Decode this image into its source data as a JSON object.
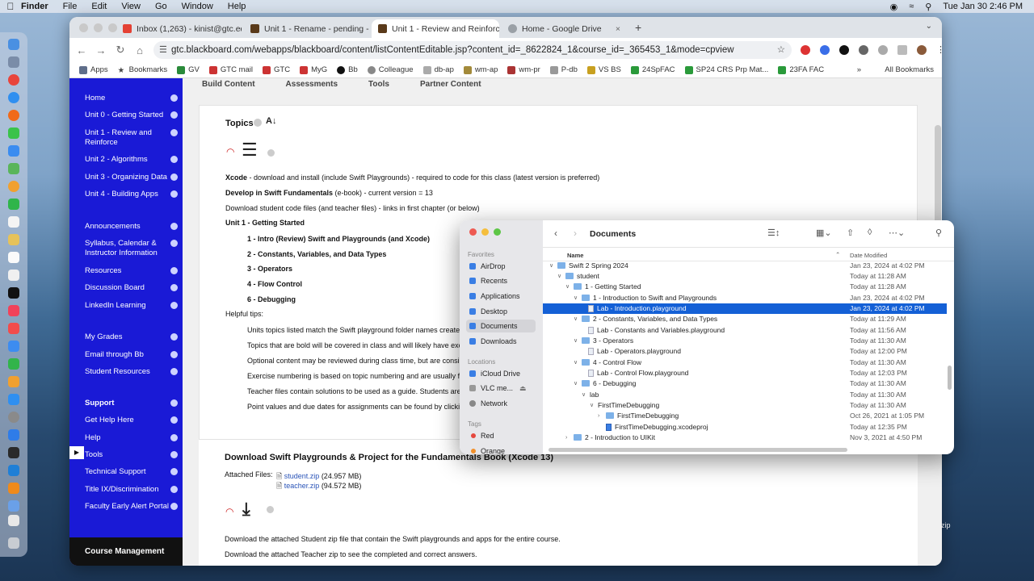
{
  "menubar": {
    "app": "Finder",
    "items": [
      "File",
      "Edit",
      "View",
      "Go",
      "Window",
      "Help"
    ],
    "clock": "Tue Jan 30  2:46 PM"
  },
  "browser": {
    "tabs": [
      {
        "label": "Inbox (1,263) - kinist@gtc.ed"
      },
      {
        "label": "Unit 1 - Rename - pending -"
      },
      {
        "label": "Unit 1 - Review and Reinforce"
      },
      {
        "label": "Home - Google Drive"
      }
    ],
    "new_tab": "+",
    "url": "gtc.blackboard.com/webapps/blackboard/content/listContentEditable.jsp?content_id=_8622824_1&course_id=_365453_1&mode=cpview",
    "bookmarks": [
      "Apps",
      "Bookmarks",
      "GV",
      "GTC mail",
      "GTC",
      "MyG",
      "Bb",
      "Colleague",
      "db-ap",
      "wm-ap",
      "wm-pr",
      "P-db",
      "VS BS",
      "24SpFAC",
      "SP24 CRS Prp Mat...",
      "23FA FAC"
    ],
    "all_bookmarks": "All Bookmarks"
  },
  "sidebar": {
    "items": [
      "Home",
      "Unit 0 - Getting Started",
      "Unit 1 - Review and Reinforce",
      "Unit 2 - Algorithms",
      "Unit 3 - Organizing Data",
      "Unit 4 - Building Apps",
      "Announcements",
      "Syllabus, Calendar & Instructor Information",
      "Resources",
      "Discussion Board",
      "LinkedIn Learning",
      "My Grades",
      "Email through Bb",
      "Student Resources",
      "Support",
      "Get Help Here",
      "Help",
      "Tools",
      "Technical Support",
      "Title IX/Discrimination",
      "Faculty Early Alert Portal"
    ],
    "course_management": "Course Management"
  },
  "main": {
    "toptabs": [
      "Build Content",
      "Assessments",
      "Tools",
      "Partner Content"
    ],
    "topics_title": "Topics",
    "line1_bold": "Xcode",
    "line1": " - download and install (include Swift Playgrounds) - required to code for this class (latest version is preferred)",
    "line2_bold": "Develop in Swift Fundamentals",
    "line2": " (e-book) - current version = 13",
    "line3": "Download student code files (and teacher files) - links in first chapter (or below)",
    "unit_heading": "Unit 1 - Getting Started",
    "topics": [
      "1 - Intro (Review) Swift and Playgrounds (and Xcode)",
      "2 - Constants, Variables, and Data Types",
      "3 - Operators",
      "4 - Flow Control",
      "6 - Debugging"
    ],
    "helpful": "Helpful tips:",
    "tips": [
      "Units topics listed match the Swift playground folder names created",
      "Topics that are bold will be covered in class and will likely have exe",
      "Optional content may be reviewed during class time, but are consic",
      "Exercise numbering is based on topic numbering and are usually fo",
      "Teacher files contain solutions to be used as a guide. Students are",
      "Point values and due dates for assignments can be found by clickin"
    ],
    "download_title": "Download Swift Playgrounds & Project for the Fundamentals Book (Xcode 13)",
    "attached": "Attached Files:",
    "files": [
      {
        "name": "student.zip",
        "size": "(24.957 MB)"
      },
      {
        "name": "teacher.zip",
        "size": "(94.572 MB)"
      }
    ],
    "dl1": "Download the attached Student zip file that contain the Swift playgrounds and apps for the entire course.",
    "dl2": "Download the attached Teacher zip to see the completed and correct answers."
  },
  "finder": {
    "title": "Documents",
    "favorites_label": "Favorites",
    "favorites": [
      "AirDrop",
      "Recents",
      "Applications",
      "Desktop",
      "Documents",
      "Downloads"
    ],
    "locations_label": "Locations",
    "locations": [
      "iCloud Drive",
      "VLC me...",
      "Network"
    ],
    "tags_label": "Tags",
    "tags": [
      "Red",
      "Orange"
    ],
    "col_name": "Name",
    "col_date": "Date Modified",
    "rows": [
      {
        "name": "Swift 2 Spring 2024",
        "date": "Jan 23, 2024 at 4:02 PM"
      },
      {
        "name": "student",
        "date": "Today at 11:28 AM"
      },
      {
        "name": "1 - Getting Started",
        "date": "Today at 11:28 AM"
      },
      {
        "name": "1 - Introduction to Swift and Playgrounds",
        "date": "Jan 23, 2024 at 4:02 PM"
      },
      {
        "name": "Lab - Introduction.playground",
        "date": "Jan 23, 2024 at 4:02 PM"
      },
      {
        "name": "2 - Constants, Variables, and Data Types",
        "date": "Today at 11:29 AM"
      },
      {
        "name": "Lab - Constants and Variables.playground",
        "date": "Today at 11:56 AM"
      },
      {
        "name": "3 - Operators",
        "date": "Today at 11:30 AM"
      },
      {
        "name": "Lab - Operators.playground",
        "date": "Today at 12:00 PM"
      },
      {
        "name": "4 - Control Flow",
        "date": "Today at 11:30 AM"
      },
      {
        "name": "Lab - Control Flow.playground",
        "date": "Today at 12:03 PM"
      },
      {
        "name": "6 - Debugging",
        "date": "Today at 11:30 AM"
      },
      {
        "name": "lab",
        "date": "Today at 11:30 AM"
      },
      {
        "name": "FirstTimeDebugging",
        "date": "Today at 11:30 AM"
      },
      {
        "name": "FirstTimeDebugging",
        "date": "Oct 26, 2021 at 1:05 PM"
      },
      {
        "name": "FirstTimeDebugging.xcodeproj",
        "date": "Today at 12:35 PM"
      },
      {
        "name": "2 - Introduction to UIKit",
        "date": "Nov 3, 2021 at 4:50 PM"
      }
    ]
  },
  "desktop": {
    "zip_label": "zip"
  }
}
